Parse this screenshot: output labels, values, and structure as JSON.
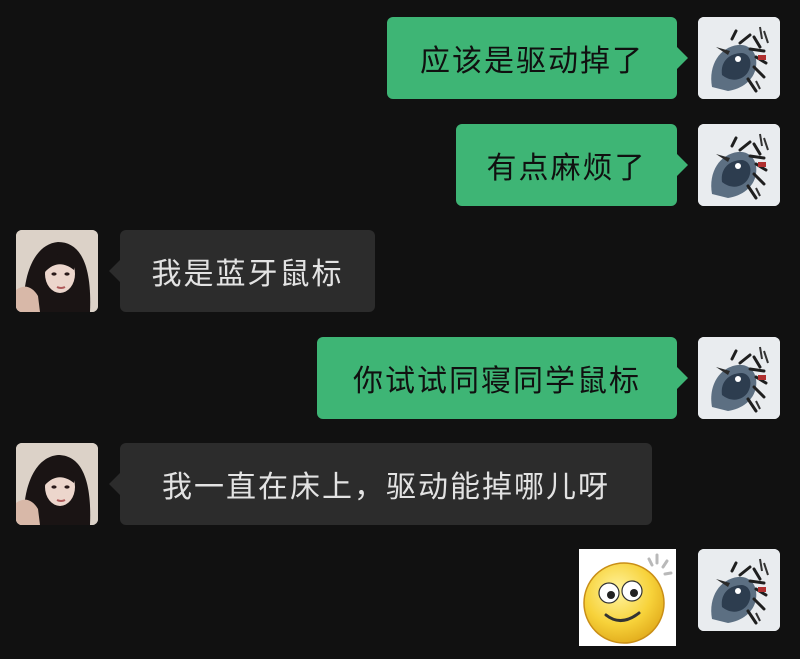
{
  "messages": [
    {
      "sender": "me",
      "text": "应该是驱动掉了"
    },
    {
      "sender": "me",
      "text": "有点麻烦了"
    },
    {
      "sender": "other",
      "text": "我是蓝牙鼠标"
    },
    {
      "sender": "me",
      "text": "你试试同寝同学鼠标"
    },
    {
      "sender": "other",
      "text": "我一直在床上，驱动能掉哪儿呀"
    },
    {
      "sender": "me",
      "type": "sticker",
      "sticker": "dizzy-smiley-sticker"
    }
  ],
  "colors": {
    "background": "#111111",
    "my_bubble": "#3eb575",
    "other_bubble": "#2c2c2c"
  },
  "icons": {
    "my_avatar": "bird-ink-painting-avatar",
    "other_avatar": "woman-portrait-avatar"
  }
}
